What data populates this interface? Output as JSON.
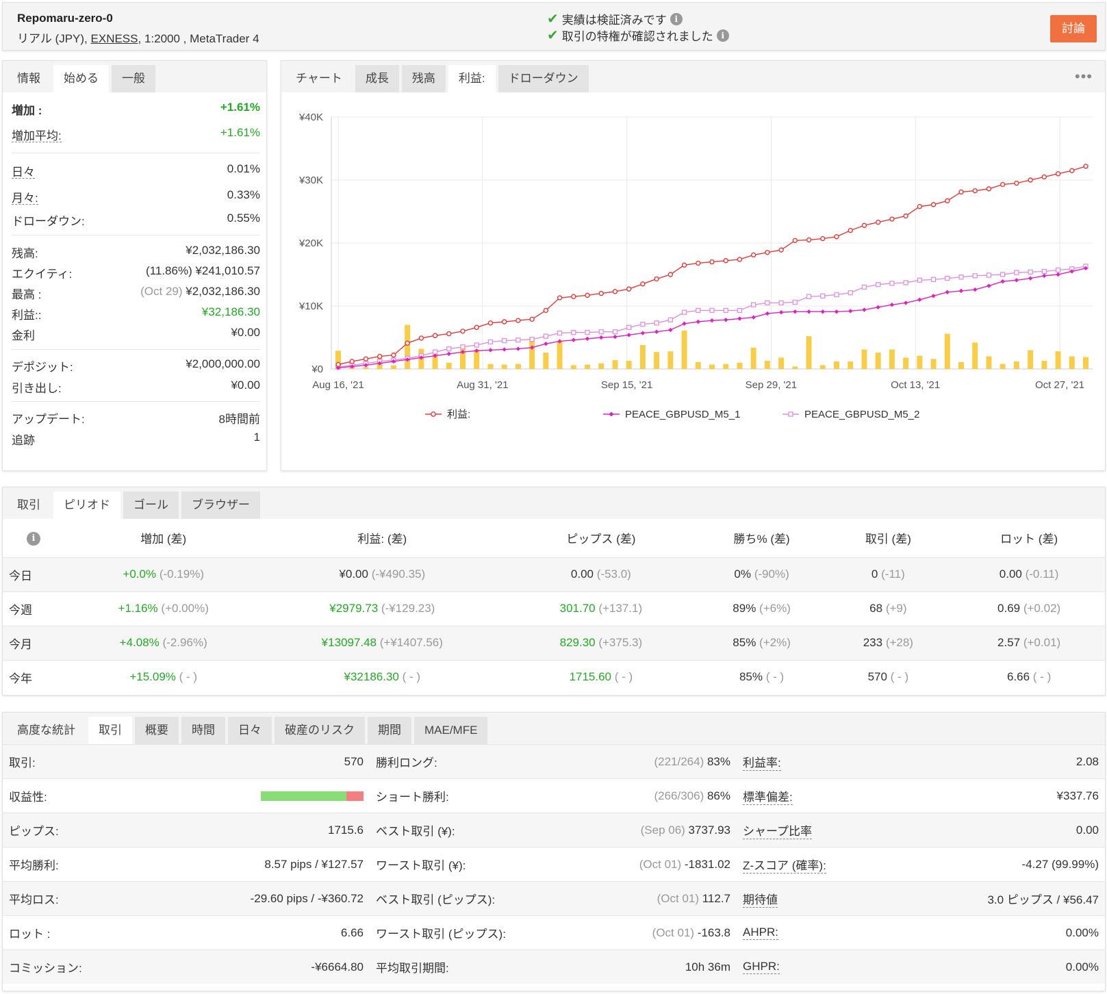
{
  "header": {
    "account_name": "Repomaru-zero-0",
    "account_type": "リアル (JPY),",
    "broker": "EXNESS",
    "leverage_platform": ", 1:2000 , MetaTrader 4",
    "verified_track": "実績は検証済みです",
    "verified_privileges": "取引の特権が確認されました",
    "discuss_button": "討論"
  },
  "info_tabs": [
    "情報",
    "始める",
    "一般"
  ],
  "info": {
    "gain_label": "増加 :",
    "gain_value": "+1.61%",
    "abs_gain_label": "増加平均:",
    "abs_gain_value": "+1.61%",
    "daily_label": "日々",
    "daily_value": "0.01%",
    "monthly_label": "月々:",
    "monthly_value": "0.33%",
    "drawdown_label": "ドローダウン:",
    "drawdown_value": "0.55%",
    "balance_label": "残高:",
    "balance_value": "¥2,032,186.30",
    "equity_label": "エクイティ:",
    "equity_value": "(11.86%) ¥241,010.57",
    "highest_label": "最高 :",
    "highest_date": "(Oct 29)",
    "highest_value": "¥2,032,186.30",
    "profit_label": "利益::",
    "profit_value": "¥32,186.30",
    "interest_label": "金利",
    "interest_value": "¥0.00",
    "deposits_label": "デポジット:",
    "deposits_value": "¥2,000,000.00",
    "withdrawals_label": "引き出し:",
    "withdrawals_value": "¥0.00",
    "updated_label": "アップデート:",
    "updated_value": "8時間前",
    "tracking_label": "追跡",
    "tracking_value": "1"
  },
  "chart_tabs": [
    "チャート",
    "成長",
    "残高",
    "利益:",
    "ドローダウン"
  ],
  "chart_data": {
    "type": "line",
    "x_ticks": [
      "Aug 16, '21",
      "Aug 31, '21",
      "Sep 15, '21",
      "Sep 29, '21",
      "Oct 13, '21",
      "Oct 27, '21"
    ],
    "y_ticks": [
      "¥0",
      "¥10K",
      "¥20K",
      "¥30K",
      "¥40K"
    ],
    "ylim": [
      0,
      40000
    ],
    "grid": true,
    "legend_position": "bottom",
    "series": [
      {
        "name": "利益:",
        "color": "#e53935",
        "marker": "circle",
        "values": [
          700,
          1200,
          1600,
          2000,
          2200,
          4100,
          4900,
          5300,
          5600,
          6000,
          6600,
          7300,
          7500,
          7700,
          7900,
          9300,
          11300,
          11500,
          11700,
          12000,
          12300,
          12700,
          13500,
          14300,
          15000,
          16500,
          16800,
          17000,
          17200,
          17400,
          18100,
          18500,
          18900,
          20400,
          20500,
          20700,
          21000,
          22000,
          22800,
          23300,
          23800,
          24300,
          25800,
          26100,
          26700,
          28100,
          28300,
          28600,
          29300,
          29500,
          30000,
          30500,
          31000,
          31500,
          32186
        ]
      },
      {
        "name": "PEACE_GBPUSD_M5_1",
        "color": "#e020c0",
        "marker": "diamond",
        "values": [
          200,
          400,
          600,
          900,
          1200,
          1500,
          1800,
          2100,
          2400,
          2700,
          2900,
          3000,
          3100,
          3200,
          3400,
          4000,
          4400,
          4600,
          4800,
          5000,
          5100,
          5400,
          5700,
          5900,
          6200,
          7200,
          7500,
          7700,
          7800,
          8000,
          8200,
          8800,
          9000,
          9100,
          9100,
          9100,
          9100,
          9200,
          9400,
          9800,
          10200,
          10500,
          11000,
          11600,
          12200,
          12400,
          12600,
          13200,
          13900,
          14100,
          14400,
          14800,
          15000,
          15500,
          16000
        ]
      },
      {
        "name": "PEACE_GBPUSD_M5_2",
        "color": "#e08ee0",
        "marker": "square",
        "values": [
          300,
          600,
          900,
          1200,
          1400,
          1700,
          2100,
          2700,
          3200,
          3500,
          3800,
          4300,
          4500,
          4600,
          4700,
          5200,
          5700,
          5800,
          5800,
          5900,
          5900,
          6600,
          7100,
          7300,
          7800,
          9000,
          9300,
          9300,
          9300,
          9300,
          10200,
          10500,
          10500,
          10600,
          11500,
          11600,
          11800,
          12100,
          13000,
          13400,
          13600,
          13700,
          14100,
          14200,
          14400,
          14600,
          14800,
          14900,
          15000,
          15300,
          15400,
          15500,
          15700,
          15900,
          16300
        ]
      }
    ],
    "bars": {
      "color": "#f9cd48",
      "values": [
        2900,
        800,
        300,
        1800,
        600,
        7000,
        3200,
        2400,
        1000,
        3500,
        3100,
        800,
        700,
        800,
        5100,
        2600,
        4400,
        600,
        700,
        900,
        1400,
        1300,
        3800,
        2700,
        2800,
        6100,
        1100,
        700,
        800,
        1000,
        3400,
        1300,
        1800,
        400,
        5200,
        600,
        1200,
        1200,
        3100,
        2600,
        3100,
        1800,
        2100,
        1600,
        5600,
        1100,
        4200,
        2000,
        800,
        1200,
        3000,
        1300,
        2800,
        2000,
        1900
      ]
    }
  },
  "period_tabs": [
    "取引",
    "ピリオド",
    "ゴール",
    "ブラウザー"
  ],
  "period": {
    "headers": [
      "増加 (差)",
      "利益: (差)",
      "ピップス (差)",
      "勝ち% (差)",
      "取引 (差)",
      "ロット (差)"
    ],
    "rows": [
      {
        "label": "今日",
        "gain": "+0.0%",
        "gain_diff": "(-0.19%)",
        "profit": "¥0.00",
        "profit_diff": "(-¥490.35)",
        "pips": "0.00",
        "pips_diff": "(-53.0)",
        "won": "0%",
        "won_diff": "(-90%)",
        "trades": "0",
        "trades_diff": "(-11)",
        "lots": "0.00",
        "lots_diff": "(-0.11)"
      },
      {
        "label": "今週",
        "gain": "+1.16%",
        "gain_diff": "(+0.00%)",
        "profit": "¥2979.73",
        "profit_diff": "(-¥129.23)",
        "pips": "301.70",
        "pips_diff": "(+137.1)",
        "won": "89%",
        "won_diff": "(+6%)",
        "trades": "68",
        "trades_diff": "(+9)",
        "lots": "0.69",
        "lots_diff": "(+0.02)"
      },
      {
        "label": "今月",
        "gain": "+4.08%",
        "gain_diff": "(-2.96%)",
        "profit": "¥13097.48",
        "profit_diff": "(+¥1407.56)",
        "pips": "829.30",
        "pips_diff": "(+375.3)",
        "won": "85%",
        "won_diff": "(+2%)",
        "trades": "233",
        "trades_diff": "(+28)",
        "lots": "2.57",
        "lots_diff": "(+0.01)"
      },
      {
        "label": "今年",
        "gain": "+15.09%",
        "gain_diff": "( - )",
        "profit": "¥32186.30",
        "profit_diff": "( - )",
        "pips": "1715.60",
        "pips_diff": "( - )",
        "won": "85%",
        "won_diff": "( - )",
        "trades": "570",
        "trades_diff": "( - )",
        "lots": "6.66",
        "lots_diff": "( - )"
      }
    ]
  },
  "stats_tabs": [
    "高度な統計",
    "取引",
    "概要",
    "時間",
    "日々",
    "破産のリスク",
    "期間",
    "MAE/MFE"
  ],
  "stats": {
    "col1": [
      {
        "label": "取引:",
        "value": "570"
      },
      {
        "label": "収益性:",
        "profitability_pct": 83
      },
      {
        "label": "ピップス:",
        "value": "1715.6"
      },
      {
        "label": "平均勝利:",
        "value": "8.57 pips / ¥127.57"
      },
      {
        "label": "平均ロス:",
        "value": "-29.60 pips / -¥360.72"
      },
      {
        "label": "ロット :",
        "value": "6.66"
      },
      {
        "label": "コミッション:",
        "value": "-¥6664.80"
      }
    ],
    "col2": [
      {
        "label": "勝利ロング:",
        "pre": "(221/264)",
        "value": "83%"
      },
      {
        "label": "ショート勝利:",
        "pre": "(266/306)",
        "value": "86%"
      },
      {
        "label": "ベスト取引 (¥):",
        "pre": "(Sep 06)",
        "value": "3737.93"
      },
      {
        "label": "ワースト取引 (¥):",
        "pre": "(Oct 01)",
        "value": "-1831.02"
      },
      {
        "label": "ベスト取引 (ピップス):",
        "pre": "(Oct 01)",
        "value": "112.7"
      },
      {
        "label": "ワースト取引 (ピップス):",
        "pre": "(Oct 01)",
        "value": "-163.8"
      },
      {
        "label": "平均取引期間:",
        "pre": "",
        "value": "10h 36m"
      }
    ],
    "col3": [
      {
        "label": "利益率:",
        "value": "2.08"
      },
      {
        "label": "標準偏差:",
        "value": "¥337.76"
      },
      {
        "label": "シャープ比率",
        "value": "0.00"
      },
      {
        "label": "Z-スコア (確率):",
        "value": "-4.27 (99.99%)"
      },
      {
        "label": "期待値",
        "value": "3.0 ピップス / ¥56.47"
      },
      {
        "label": "AHPR:",
        "value": "0.00%"
      },
      {
        "label": "GHPR:",
        "value": "0.00%"
      }
    ]
  }
}
